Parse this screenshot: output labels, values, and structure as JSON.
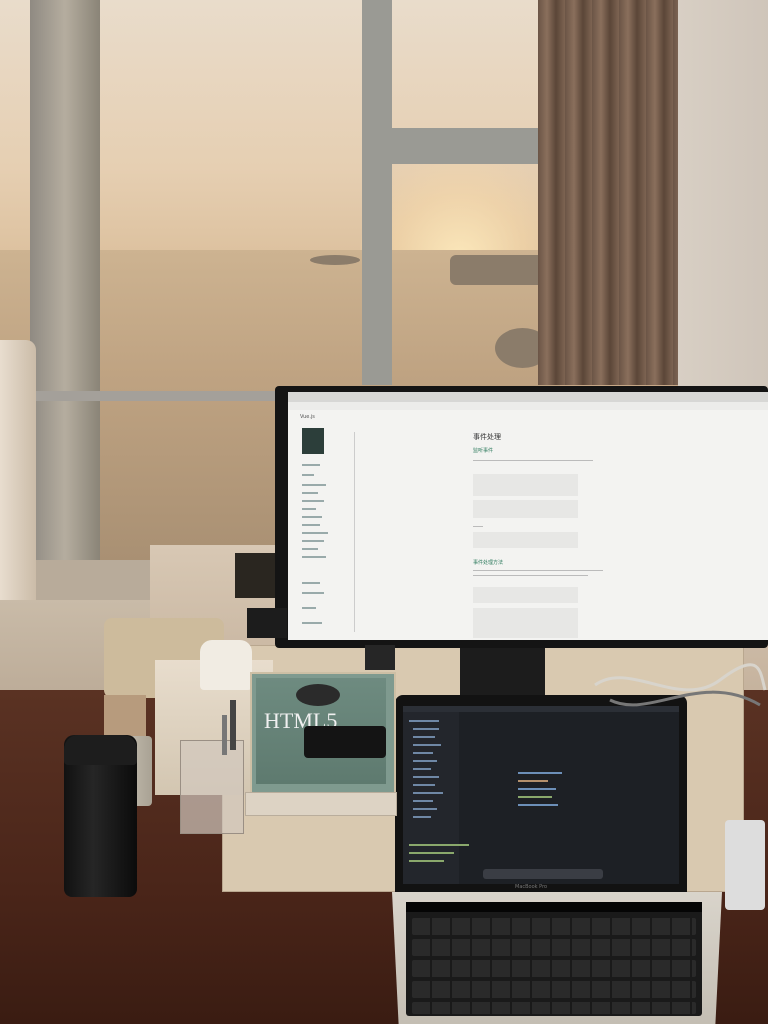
{
  "scene": {
    "alt": "Desk setup in front of a large window overlooking the sea at sunset, with an external monitor showing documentation and a laptop showing a code editor",
    "colors": {
      "sky": "#e6cfb2",
      "sea": "#bfa382",
      "desk": "#4a2519",
      "monitor_screen": "#f3f3f1",
      "laptop_screen": "#1d2025"
    }
  },
  "monitor": {
    "doc_title": "事件处理",
    "section_1": "监听事件",
    "section_2": "事件处理方法",
    "sidebar_header": "Vue.js"
  },
  "book": {
    "title": "HTML5"
  },
  "laptop": {
    "brand": "MacBook Pro"
  }
}
